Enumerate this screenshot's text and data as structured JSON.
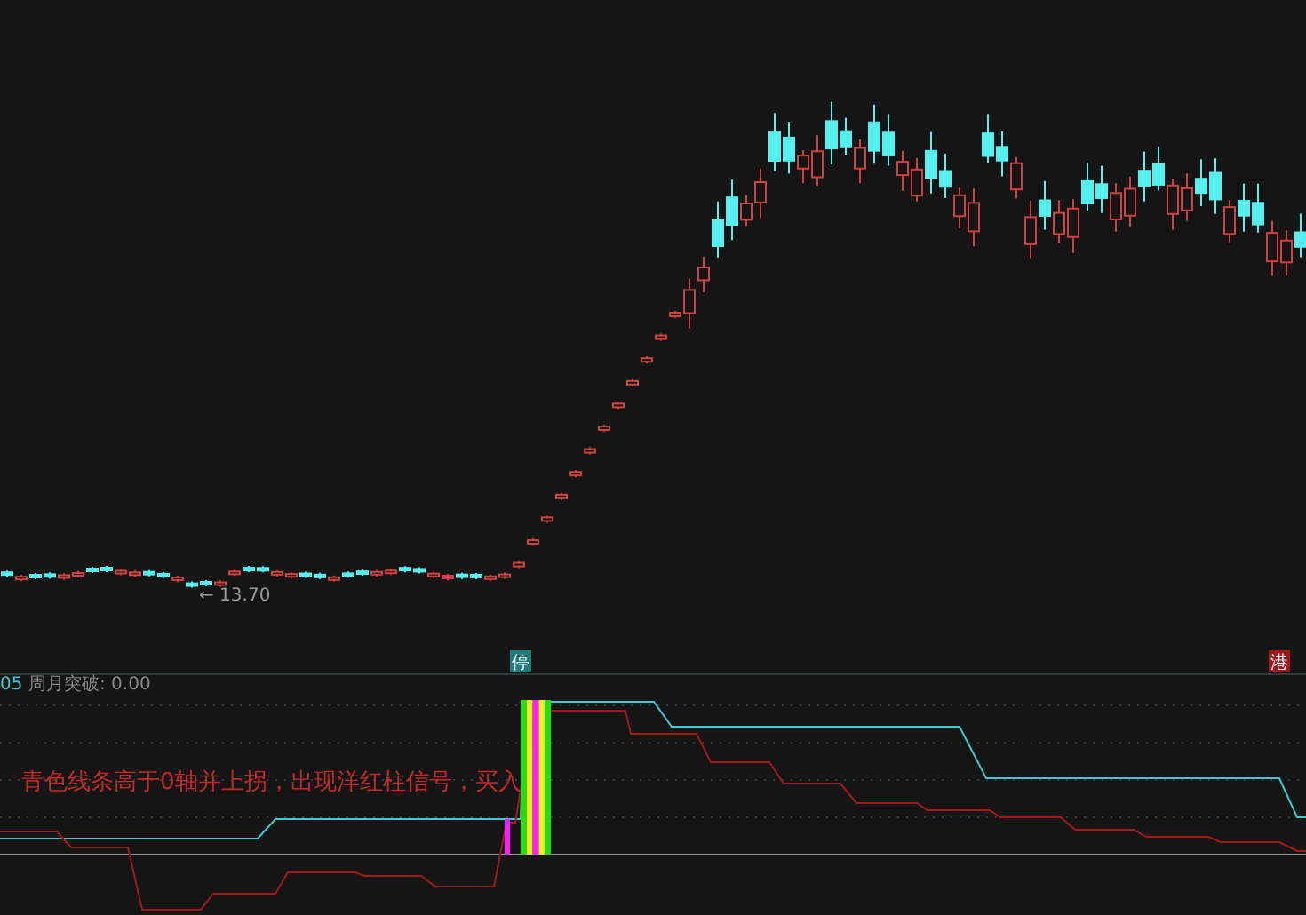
{
  "price_chart": {
    "low_marker": "← 13.70",
    "badges": [
      {
        "text": "停",
        "color": "#1f7c7c"
      },
      {
        "text": "港",
        "color": "#9a1a20"
      }
    ]
  },
  "indicator": {
    "index_label": "05",
    "name": "周月突破: 0.00",
    "annotation": "青色线条高于0轴并上拐，出现洋红柱信号，买入"
  }
}
